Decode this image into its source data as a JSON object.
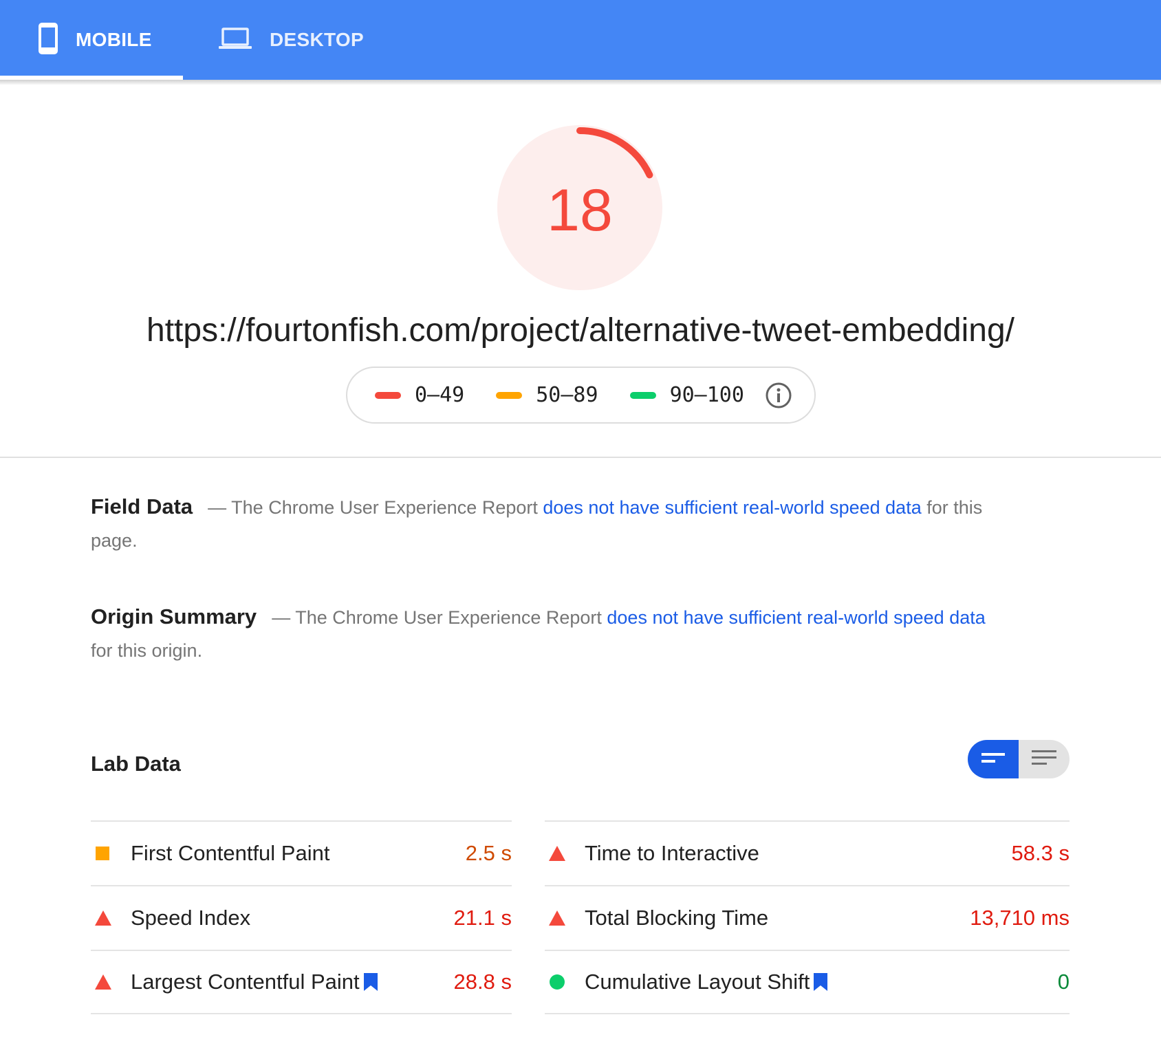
{
  "tabs": [
    {
      "label": "MOBILE",
      "icon": "phone-icon",
      "active": true
    },
    {
      "label": "DESKTOP",
      "icon": "laptop-icon",
      "active": false
    }
  ],
  "score": {
    "value": "18",
    "fraction": 0.18,
    "color": "#f4493c"
  },
  "url": "https://fourtonfish.com/project/alternative-tweet-embedding/",
  "legend": [
    {
      "range": "0–49",
      "color": "#f4493c"
    },
    {
      "range": "50–89",
      "color": "#ffa400"
    },
    {
      "range": "90–100",
      "color": "#0cce6b"
    }
  ],
  "field_data": {
    "heading": "Field Data",
    "prefix": "— The Chrome User Experience Report ",
    "link": "does not have sufficient real-world speed data",
    "suffix": " for this page."
  },
  "origin_summary": {
    "heading": "Origin Summary",
    "prefix": "— The Chrome User Experience Report ",
    "link": "does not have sufficient real-world speed data",
    "suffix": " for this origin."
  },
  "lab_data": {
    "title": "Lab Data",
    "metrics_left": [
      {
        "name": "First Contentful Paint",
        "value": "2.5 s",
        "status": "average",
        "icon": "orange-square-icon",
        "bookmark": false
      },
      {
        "name": "Speed Index",
        "value": "21.1 s",
        "status": "fail",
        "icon": "red-triangle-icon",
        "bookmark": false
      },
      {
        "name": "Largest Contentful Paint",
        "value": "28.8 s",
        "status": "fail",
        "icon": "red-triangle-icon",
        "bookmark": true
      }
    ],
    "metrics_right": [
      {
        "name": "Time to Interactive",
        "value": "58.3 s",
        "status": "fail",
        "icon": "red-triangle-icon",
        "bookmark": false
      },
      {
        "name": "Total Blocking Time",
        "value": "13,710 ms",
        "status": "fail",
        "icon": "red-triangle-icon",
        "bookmark": false
      },
      {
        "name": "Cumulative Layout Shift",
        "value": "0",
        "status": "pass",
        "icon": "green-circle-icon",
        "bookmark": true
      }
    ]
  }
}
